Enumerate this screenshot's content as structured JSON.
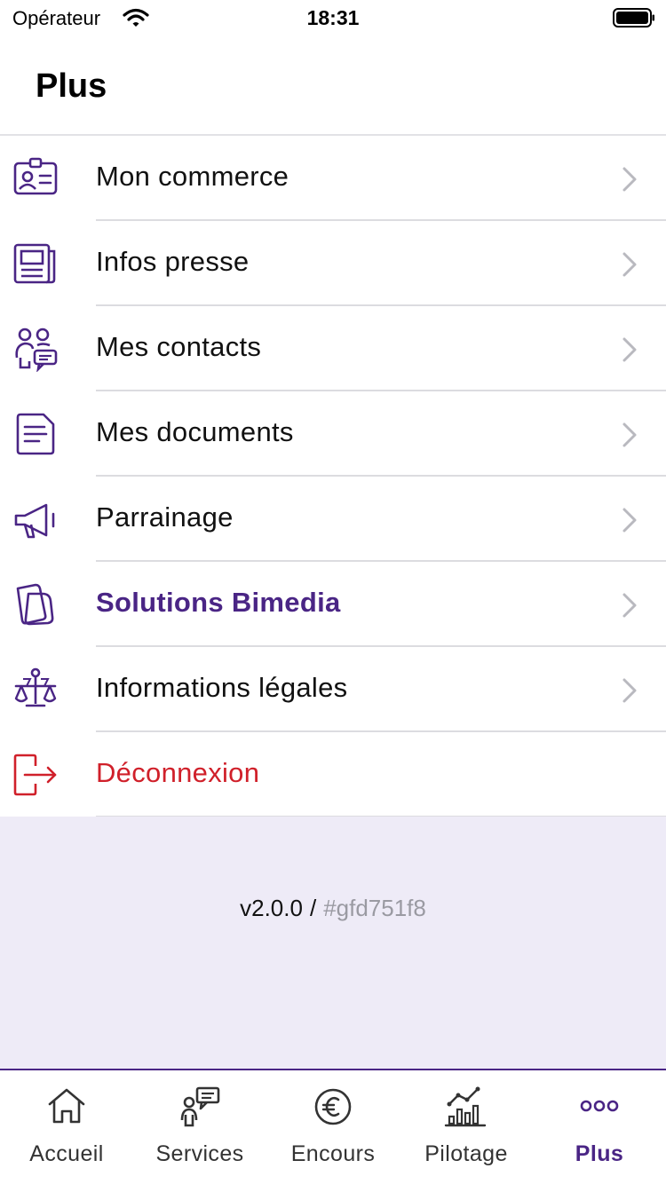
{
  "status_bar": {
    "carrier": "Opérateur",
    "time": "18:31"
  },
  "header": {
    "title": "Plus"
  },
  "menu": {
    "items": [
      {
        "label": "Mon commerce",
        "icon": "id-card-icon"
      },
      {
        "label": "Infos presse",
        "icon": "newspaper-icon"
      },
      {
        "label": "Mes contacts",
        "icon": "contacts-icon"
      },
      {
        "label": "Mes documents",
        "icon": "document-icon"
      },
      {
        "label": "Parrainage",
        "icon": "megaphone-icon"
      },
      {
        "label": "Solutions Bimedia",
        "icon": "bimedia-logo-icon"
      },
      {
        "label": "Informations légales",
        "icon": "scales-icon"
      },
      {
        "label": "Déconnexion",
        "icon": "logout-icon"
      }
    ]
  },
  "footer": {
    "version": "v2.0.0",
    "separator": "/",
    "hash": "#gfd751f8"
  },
  "tabbar": {
    "tabs": [
      {
        "label": "Accueil",
        "icon": "home-icon"
      },
      {
        "label": "Services",
        "icon": "services-icon"
      },
      {
        "label": "Encours",
        "icon": "euro-icon"
      },
      {
        "label": "Pilotage",
        "icon": "chart-icon"
      },
      {
        "label": "Plus",
        "icon": "more-icon",
        "active": true
      }
    ]
  },
  "colors": {
    "brand": "#4a2585",
    "danger": "#d0202a",
    "footer_bg": "#eeebf7",
    "divider": "#dcdce0"
  }
}
